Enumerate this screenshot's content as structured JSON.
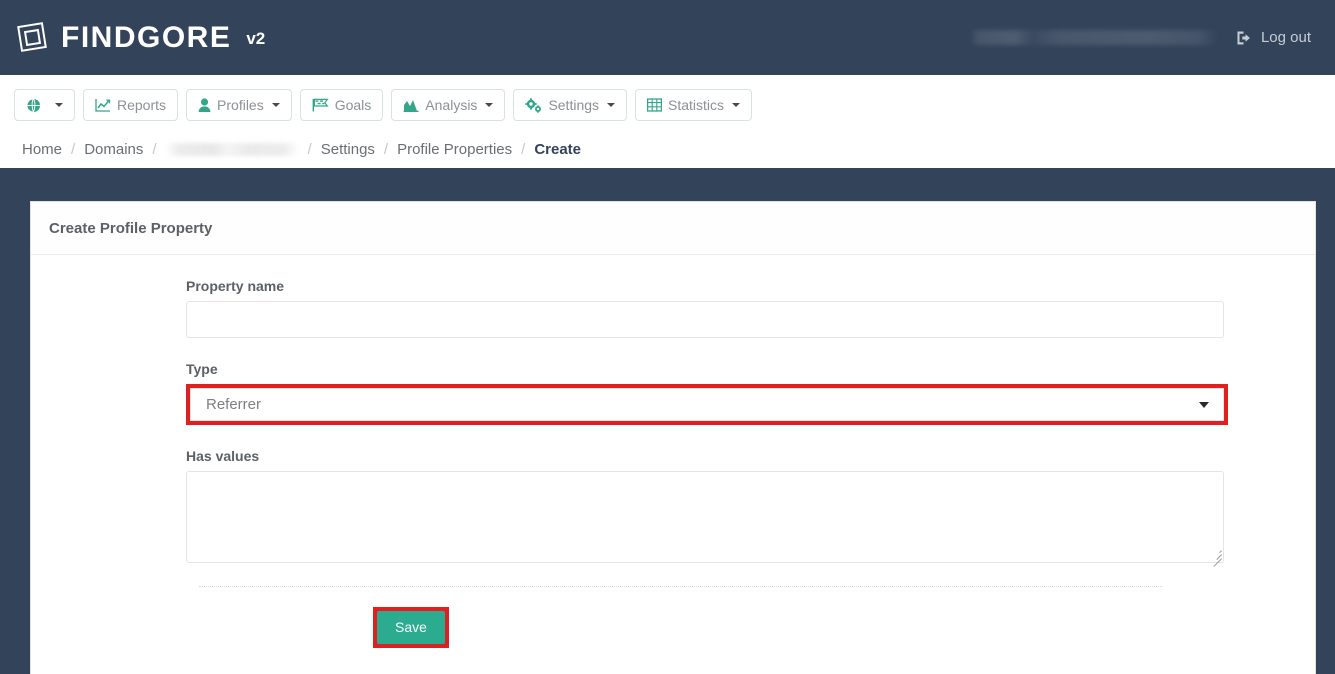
{
  "header": {
    "brand_name": "FINDGORE",
    "brand_version": "v2",
    "logo_icon": "rotated-square-logo",
    "user_label": "",
    "logout_label": "Log out",
    "logout_icon": "sign-out-icon"
  },
  "nav": {
    "items": [
      {
        "label": "",
        "icon": "globe-icon",
        "caret": true
      },
      {
        "label": "Reports",
        "icon": "line-chart-icon",
        "caret": false
      },
      {
        "label": "Profiles",
        "icon": "user-icon",
        "caret": true
      },
      {
        "label": "Goals",
        "icon": "flag-icon",
        "caret": false
      },
      {
        "label": "Analysis",
        "icon": "area-chart-icon",
        "caret": true
      },
      {
        "label": "Settings",
        "icon": "gears-icon",
        "caret": true
      },
      {
        "label": "Statistics",
        "icon": "table-icon",
        "caret": true
      }
    ]
  },
  "breadcrumb": {
    "items": [
      {
        "label": "Home",
        "active": false,
        "blurred": false
      },
      {
        "label": "Domains",
        "active": false,
        "blurred": false
      },
      {
        "label": "",
        "active": false,
        "blurred": true
      },
      {
        "label": "Settings",
        "active": false,
        "blurred": false
      },
      {
        "label": "Profile Properties",
        "active": false,
        "blurred": false
      },
      {
        "label": "Create",
        "active": true,
        "blurred": false
      }
    ],
    "separator": "/"
  },
  "card": {
    "title": "Create Profile Property",
    "fields": {
      "property_name": {
        "label": "Property name",
        "value": "",
        "placeholder": ""
      },
      "type": {
        "label": "Type",
        "value": "Referrer",
        "arrow_icon": "chevron-down-icon"
      },
      "has_values": {
        "label": "Has values",
        "value": "",
        "placeholder": ""
      }
    },
    "save_label": "Save"
  },
  "colors": {
    "header_bg": "#33435a",
    "accent_teal": "#2bab8f",
    "annotation_red": "#e02020",
    "body_text": "#5b6166"
  }
}
